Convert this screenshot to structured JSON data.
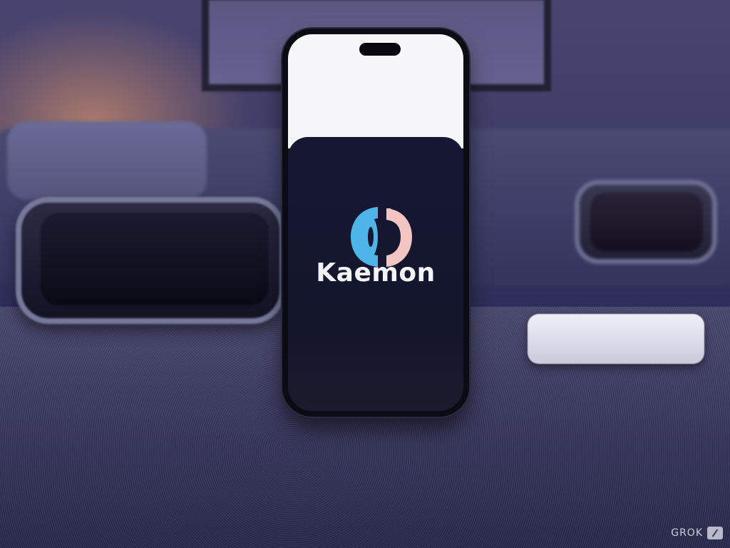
{
  "scene": {
    "app_name": "Kaemon",
    "watermark": "GROK"
  },
  "colors": {
    "logo_blue": "#4fb4e8",
    "logo_pink": "#f2c4c2",
    "screen_dark": "#14162c",
    "screen_light": "#f7f7f9",
    "ambient_glow": "#ffaa6e"
  },
  "icons": {
    "app_logo": "kaemon-logo-icon",
    "watermark_mark": "grok-mark-icon"
  }
}
